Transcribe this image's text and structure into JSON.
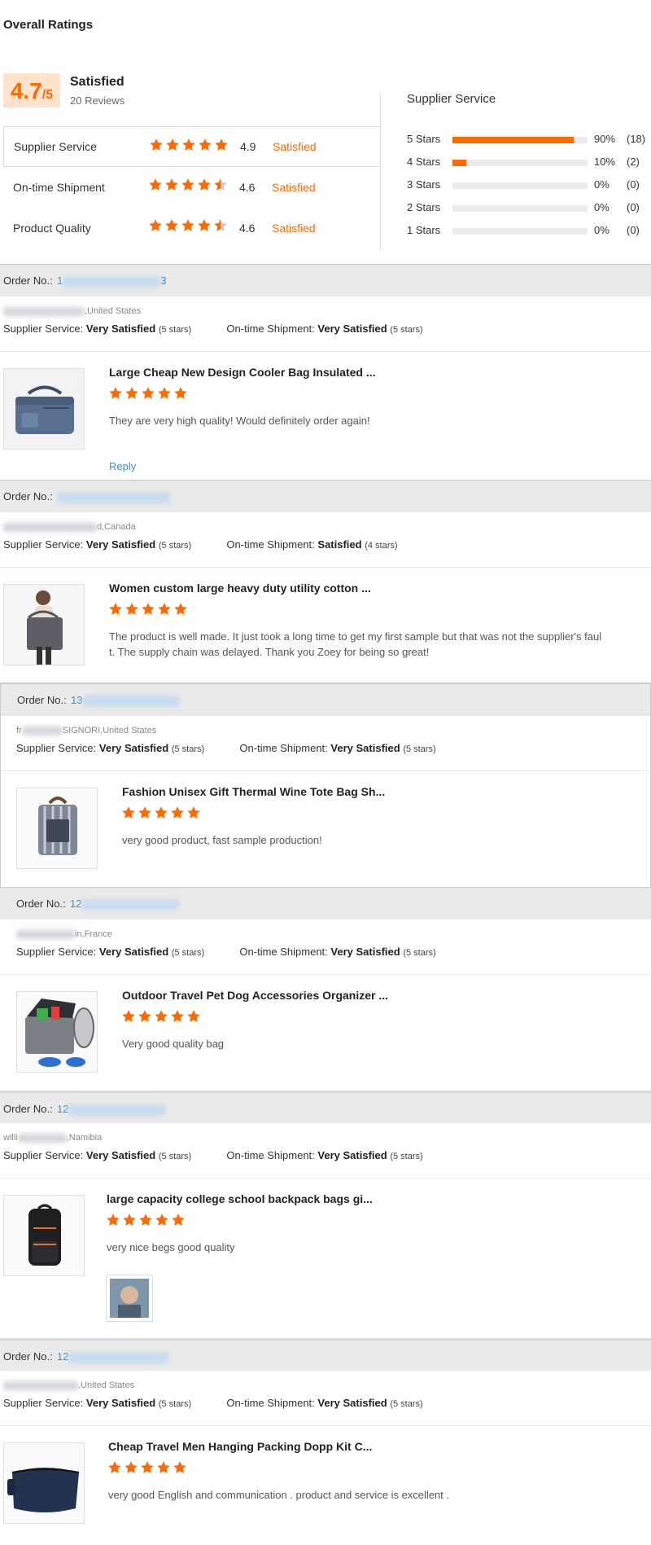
{
  "overall": {
    "section_title": "Overall Ratings",
    "score": "4.7",
    "score_suffix": "/5",
    "label": "Satisfied",
    "review_count": "20 Reviews",
    "metrics": [
      {
        "label": "Supplier Service",
        "stars": 5,
        "score": "4.9",
        "status": "Satisfied"
      },
      {
        "label": "On-time Shipment",
        "stars": 4.5,
        "score": "4.6",
        "status": "Satisfied"
      },
      {
        "label": "Product Quality",
        "stars": 4.5,
        "score": "4.6",
        "status": "Satisfied"
      }
    ]
  },
  "distribution": {
    "title": "Supplier Service",
    "rows": [
      {
        "label": "5 Stars",
        "percent": 90,
        "pct_text": "90%",
        "count": "(18)"
      },
      {
        "label": "4 Stars",
        "percent": 10,
        "pct_text": "10%",
        "count": "(2)"
      },
      {
        "label": "3 Stars",
        "percent": 0,
        "pct_text": "0%",
        "count": "(0)"
      },
      {
        "label": "2 Stars",
        "percent": 0,
        "pct_text": "0%",
        "count": "(0)"
      },
      {
        "label": "1 Stars",
        "percent": 0,
        "pct_text": "0%",
        "count": "(0)"
      }
    ]
  },
  "common": {
    "order_label": "Order No.:",
    "supplier_service_label": "Supplier Service:",
    "shipment_label": "On-time Shipment:",
    "reply_label": "Reply"
  },
  "colors": {
    "accent": "#ff6a00",
    "link": "#3b8ed6",
    "header_bg": "#eaeaea"
  },
  "reviews": [
    {
      "order_visible": "13 3",
      "buyer_visible": ",United States",
      "supplier_rating": "Very Satisfied",
      "supplier_stars": "(5 stars)",
      "shipment_rating": "Very Satisfied",
      "shipment_stars": "(5 stars)",
      "product_title": "Large Cheap New Design Cooler Bag Insulated ...",
      "comment": "They are very high quality! Would definitely order again!",
      "rating": 5,
      "thumb_icon": "cooler-bag-icon",
      "reply": "Reply"
    },
    {
      "order_visible": "",
      "buyer_visible": "d,Canada",
      "supplier_rating": "Very Satisfied",
      "supplier_stars": "(5 stars)",
      "shipment_rating": "Satisfied",
      "shipment_stars": "(4 stars)",
      "product_title": "Women custom large heavy duty utility cotton ...",
      "comment_line1": "The product is well made.  It just took a long time to get my first sample but that was not the supplier's faul",
      "comment_line2": "t.  The supply chain was delayed. Thank you Zoey for being so great!",
      "rating": 5,
      "thumb_icon": "tote-bag-icon"
    },
    {
      "order_visible": "13",
      "buyer_visible": "SIGNORI,United States",
      "buyer_prefix": "fr",
      "supplier_rating": "Very Satisfied",
      "supplier_stars": "(5 stars)",
      "shipment_rating": "Very Satisfied",
      "shipment_stars": "(5 stars)",
      "product_title": "Fashion Unisex Gift Thermal Wine Tote Bag Sh...",
      "comment": "very good product, fast sample production!",
      "rating": 5,
      "thumb_icon": "wine-tote-icon"
    },
    {
      "order_visible": "12",
      "buyer_visible": "in,France",
      "supplier_rating": "Very Satisfied",
      "supplier_stars": "(5 stars)",
      "shipment_rating": "Very Satisfied",
      "shipment_stars": "(5 stars)",
      "product_title": "Outdoor Travel Pet Dog Accessories Organizer ...",
      "comment": "Very good quality bag",
      "rating": 5,
      "thumb_icon": "pet-organizer-icon"
    },
    {
      "order_visible": "12",
      "buyer_visible": ",Namibia",
      "buyer_prefix": "willi",
      "supplier_rating": "Very Satisfied",
      "supplier_stars": "(5 stars)",
      "shipment_rating": "Very Satisfied",
      "shipment_stars": "(5 stars)",
      "product_title": "large capacity college school backpack bags gi...",
      "comment": "very nice begs good quality",
      "rating": 5,
      "thumb_icon": "backpack-icon",
      "photo_icon": "buyer-photo-icon"
    },
    {
      "order_visible": "12",
      "buyer_visible": ",United States",
      "supplier_rating": "Very Satisfied",
      "supplier_stars": "(5 stars)",
      "shipment_rating": "Very Satisfied",
      "shipment_stars": "(5 stars)",
      "product_title": "Cheap Travel Men Hanging Packing Dopp Kit C...",
      "comment": "very good English and communication .  product and service  is excellent .",
      "rating": 5,
      "thumb_icon": "dopp-kit-icon"
    }
  ]
}
